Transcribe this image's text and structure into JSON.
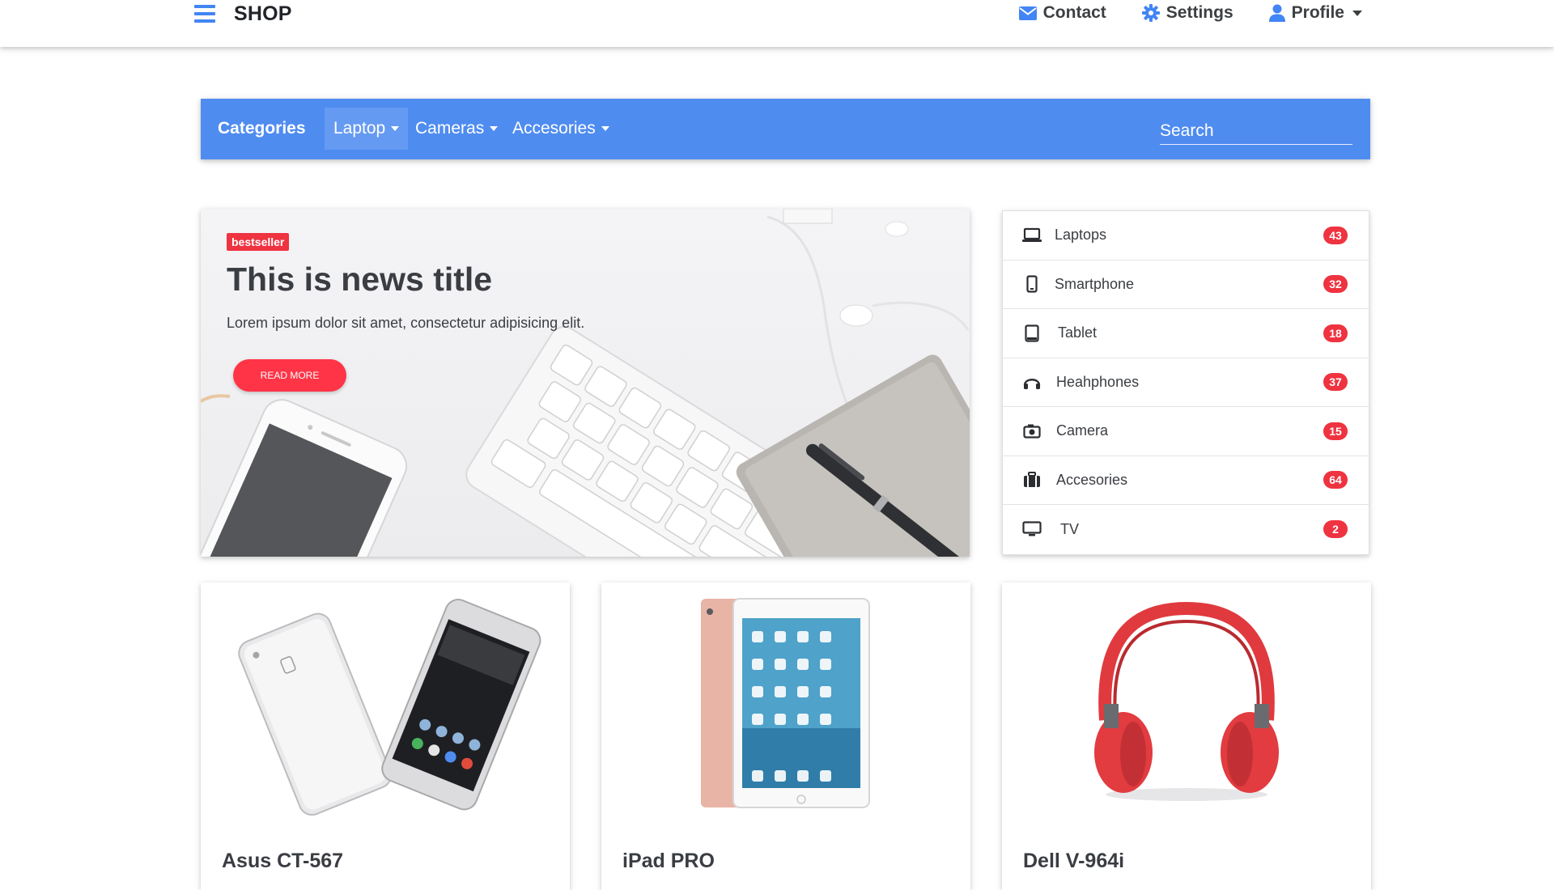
{
  "topbar": {
    "brand": "SHOP",
    "nav": [
      {
        "label": "Contact",
        "icon": "envelope-icon"
      },
      {
        "label": "Settings",
        "icon": "gear-icon"
      },
      {
        "label": "Profile",
        "icon": "user-icon"
      }
    ]
  },
  "category_bar": {
    "title": "Categories",
    "menus": [
      {
        "label": "Laptop",
        "active": true
      },
      {
        "label": "Cameras",
        "active": false
      },
      {
        "label": "Accesories",
        "active": false
      }
    ],
    "search_placeholder": "Search"
  },
  "hero": {
    "badge": "bestseller",
    "title": "This is news title",
    "description": "Lorem ipsum dolor sit amet, consectetur adipisicing elit.",
    "button": "READ MORE"
  },
  "categories": [
    {
      "label": "Laptops",
      "count": "43",
      "icon": "laptop-icon"
    },
    {
      "label": "Smartphone",
      "count": "32",
      "icon": "mobile-icon"
    },
    {
      "label": "Tablet",
      "count": "18",
      "icon": "tablet-icon"
    },
    {
      "label": "Heahphones",
      "count": "37",
      "icon": "headphones-icon"
    },
    {
      "label": "Camera",
      "count": "15",
      "icon": "camera-icon"
    },
    {
      "label": "Accesories",
      "count": "64",
      "icon": "suitcase-icon"
    },
    {
      "label": "TV",
      "count": "2",
      "icon": "tv-icon"
    }
  ],
  "products": [
    {
      "name": "Asus CT-567",
      "image": "smartphone-image"
    },
    {
      "name": "iPad PRO",
      "image": "tablet-image"
    },
    {
      "name": "Dell V-964i",
      "image": "headphones-image"
    }
  ],
  "colors": {
    "primary": "#4285f4",
    "category_bar": "#4f8cf0",
    "badge": "#ef3340",
    "button": "#ff3547"
  }
}
